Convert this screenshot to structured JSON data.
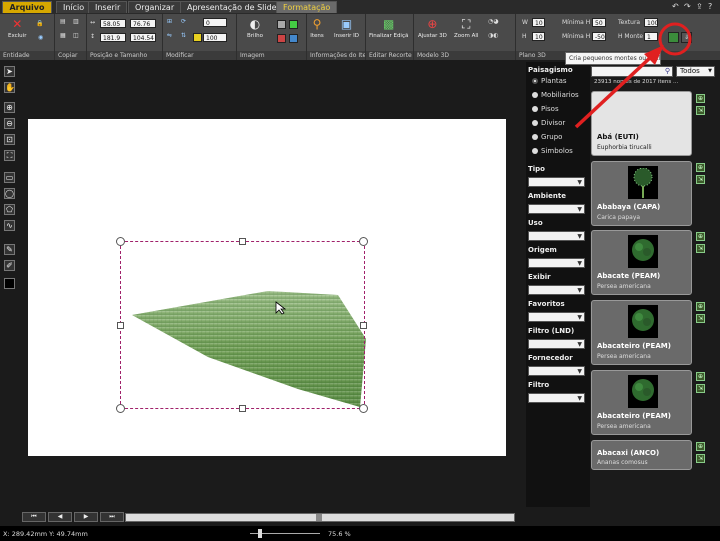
{
  "tabs": [
    {
      "label": "Arquivo"
    },
    {
      "label": "Início"
    },
    {
      "label": "Inserir"
    },
    {
      "label": "Organizar"
    },
    {
      "label": "Apresentação de Slides"
    },
    {
      "label": "Formatação"
    }
  ],
  "ribbon": {
    "groups": {
      "entidade": "Entidade",
      "copiar": "Copiar",
      "posicao": "Posição e Tamanho",
      "modificar": "Modificar",
      "imagem": "Imagem",
      "informacoes": "Informações do Item",
      "editar_recorte": "Editar Recorte",
      "modelo3d": "Modelo 3D",
      "plano3d": "Plano 3D"
    },
    "buttons": {
      "excluir": "Excluir",
      "brilho": "Brilho",
      "itens": "Itens",
      "inserir_id": "Inserir ID",
      "finalizar_edicao": "Finalizar Ediçã",
      "ajustar_3d": "Ajustar 3D",
      "zoom_all": "Zoom All"
    },
    "position": {
      "x": "58.05",
      "y": "181.9",
      "w": "76.76",
      "h": "104.54"
    },
    "modify": {
      "rotation": "0",
      "opacity": "100"
    },
    "plano": {
      "w_label": "W",
      "w_value": "10",
      "h_label": "H",
      "h_value": "10",
      "min_h_label": "Mínima H",
      "min_h_value": "50",
      "min_label": "Mínima H",
      "min_value": "-50",
      "textura_label": "Textura",
      "textura_value": "100",
      "monte_label": "H Monte",
      "monte_value": "1"
    }
  },
  "tooltip": "Cria pequenos montes ou declives.",
  "filters": {
    "paisagismo": "Paisagismo",
    "options": [
      "Plantas",
      "Mobiliarios",
      "Pisos",
      "Divisor",
      "Grupo",
      "Simbolos"
    ],
    "selected": "Plantas",
    "labels": [
      "Tipo",
      "Ambiente",
      "Uso",
      "Origem",
      "Exibir",
      "Favoritos",
      "Filtro (LND)",
      "Fornecedor",
      "Filtro"
    ]
  },
  "catalog": {
    "filter_value": "Todos",
    "count_text": "23913 nomes de 2017 itens ...",
    "items": [
      {
        "name": "Abá (EUTI)",
        "sci": "Euphorbia tirucalli"
      },
      {
        "name": "Ababaya (CAPA)",
        "sci": "Carica papaya"
      },
      {
        "name": "Abacate (PEAM)",
        "sci": "Persea americana"
      },
      {
        "name": "Abacateiro (PEAM)",
        "sci": "Persea americana"
      },
      {
        "name": "Abacateiro (PEAM)",
        "sci": "Persea americana"
      },
      {
        "name": "Abacaxi (ANCO)",
        "sci": "Ananas comosus"
      }
    ]
  },
  "status": {
    "coords": "X: 289.42mm Y: 49.74mm",
    "zoom": "75.6 %"
  },
  "colors": {
    "accent": "#d6a800",
    "highlight_circle": "#e02020",
    "selection": "#a0206a"
  }
}
